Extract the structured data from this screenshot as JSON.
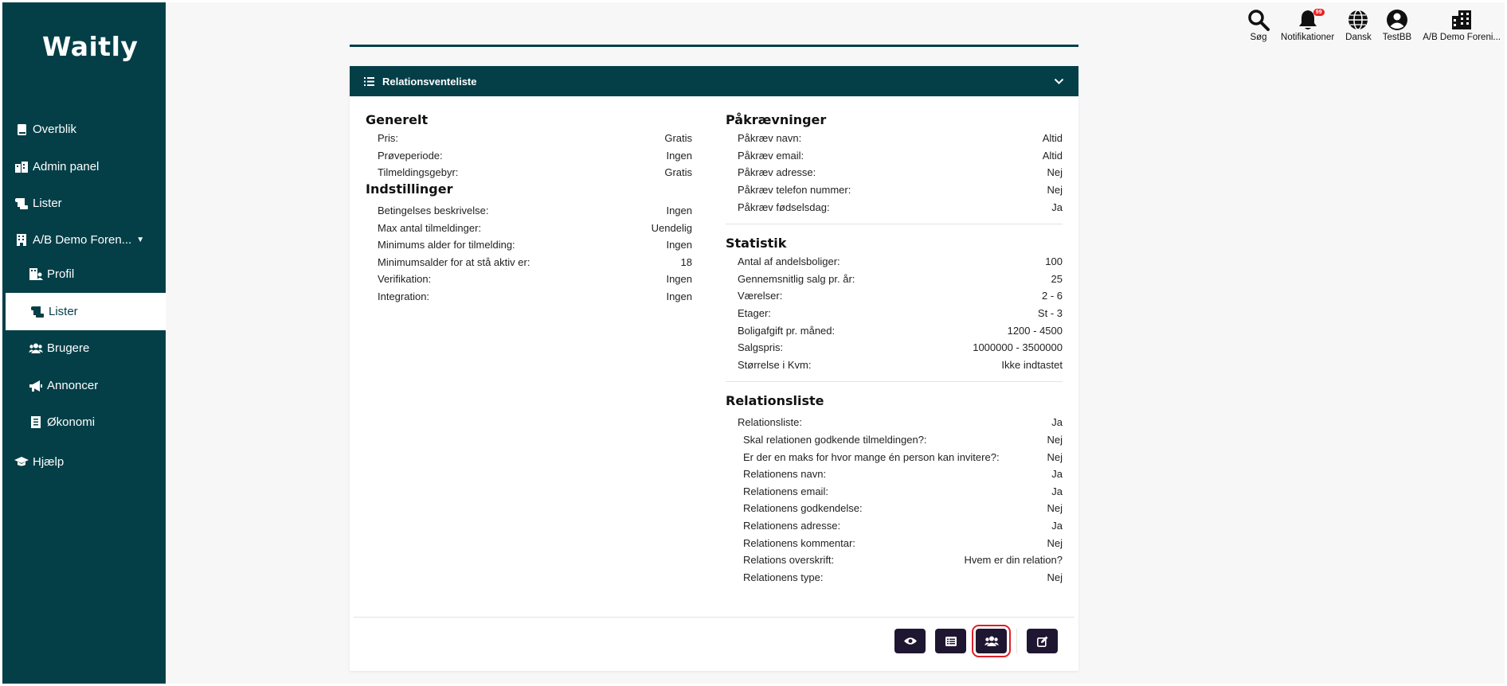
{
  "app": {
    "logo": "Waitly"
  },
  "sidebar": {
    "items": [
      {
        "label": "Overblik",
        "icon": "book-icon"
      },
      {
        "label": "Admin panel",
        "icon": "buildings-icon"
      },
      {
        "label": "Lister",
        "icon": "scroll-icon"
      },
      {
        "label": "A/B Demo Foren...",
        "icon": "building-icon"
      },
      {
        "label": "Profil",
        "icon": "building-user-icon"
      },
      {
        "label": "Lister",
        "icon": "scroll-icon"
      },
      {
        "label": "Brugere",
        "icon": "users-icon"
      },
      {
        "label": "Annoncer",
        "icon": "megaphone-icon"
      },
      {
        "label": "Økonomi",
        "icon": "receipt-icon"
      },
      {
        "label": "Hjælp",
        "icon": "graduation-cap-icon"
      }
    ]
  },
  "topbar": {
    "search": "Søg",
    "notifications": "Notifikationer",
    "notification_count": "99",
    "language": "Dansk",
    "user": "TestBB",
    "org": "A/B Demo Foreni..."
  },
  "card": {
    "title": "Relationsventeliste",
    "generelt": {
      "heading": "Generelt",
      "rows": [
        {
          "label": "Pris:",
          "value": "Gratis"
        },
        {
          "label": "Prøveperiode:",
          "value": "Ingen"
        },
        {
          "label": "Tilmeldingsgebyr:",
          "value": "Gratis"
        }
      ]
    },
    "indstillinger": {
      "heading": "Indstillinger",
      "rows": [
        {
          "label": "Betingelses beskrivelse:",
          "value": "Ingen"
        },
        {
          "label": "Max antal tilmeldinger:",
          "value": "Uendelig"
        },
        {
          "label": "Minimums alder for tilmelding:",
          "value": "Ingen"
        },
        {
          "label": "Minimumsalder for at stå aktiv er:",
          "value": "18"
        },
        {
          "label": "Verifikation:",
          "value": "Ingen"
        },
        {
          "label": "Integration:",
          "value": "Ingen"
        }
      ]
    },
    "paakraevninger": {
      "heading": "Påkrævninger",
      "rows": [
        {
          "label": "Påkræv navn:",
          "value": "Altid"
        },
        {
          "label": "Påkræv email:",
          "value": "Altid"
        },
        {
          "label": "Påkræv adresse:",
          "value": "Nej"
        },
        {
          "label": "Påkræv telefon nummer:",
          "value": "Nej"
        },
        {
          "label": "Påkræv fødselsdag:",
          "value": "Ja"
        }
      ]
    },
    "statistik": {
      "heading": "Statistik",
      "rows": [
        {
          "label": "Antal af andelsboliger:",
          "value": "100"
        },
        {
          "label": "Gennemsnitlig salg pr. år:",
          "value": "25"
        },
        {
          "label": "Værelser:",
          "value": "2 - 6"
        },
        {
          "label": "Etager:",
          "value": "St - 3"
        },
        {
          "label": "Boligafgift pr. måned:",
          "value": "1200 - 4500"
        },
        {
          "label": "Salgspris:",
          "value": "1000000 - 3500000"
        },
        {
          "label": "Størrelse i Kvm:",
          "value": "Ikke indtastet"
        }
      ]
    },
    "relationsliste": {
      "heading": "Relationsliste",
      "main": {
        "label": "Relationsliste:",
        "value": "Ja"
      },
      "rows": [
        {
          "label": "Skal relationen godkende tilmeldingen?:",
          "value": "Nej"
        },
        {
          "label": "Er der en maks for hvor mange én person kan invitere?:",
          "value": "Nej"
        },
        {
          "label": "Relationens navn:",
          "value": "Ja"
        },
        {
          "label": "Relationens email:",
          "value": "Ja"
        },
        {
          "label": "Relationens godkendelse:",
          "value": "Nej"
        },
        {
          "label": "Relationens adresse:",
          "value": "Ja"
        },
        {
          "label": "Relationens kommentar:",
          "value": "Nej"
        },
        {
          "label": "Relations overskrift:",
          "value": "Hvem er din relation?"
        },
        {
          "label": "Relationens type:",
          "value": "Nej"
        }
      ]
    },
    "actions": [
      "eye-icon",
      "list-icon",
      "users-icon",
      "edit-icon"
    ]
  },
  "colors": {
    "primary": "#043f48",
    "button": "#1f1632",
    "badge": "#e8211f",
    "highlight": "#e01f26"
  }
}
